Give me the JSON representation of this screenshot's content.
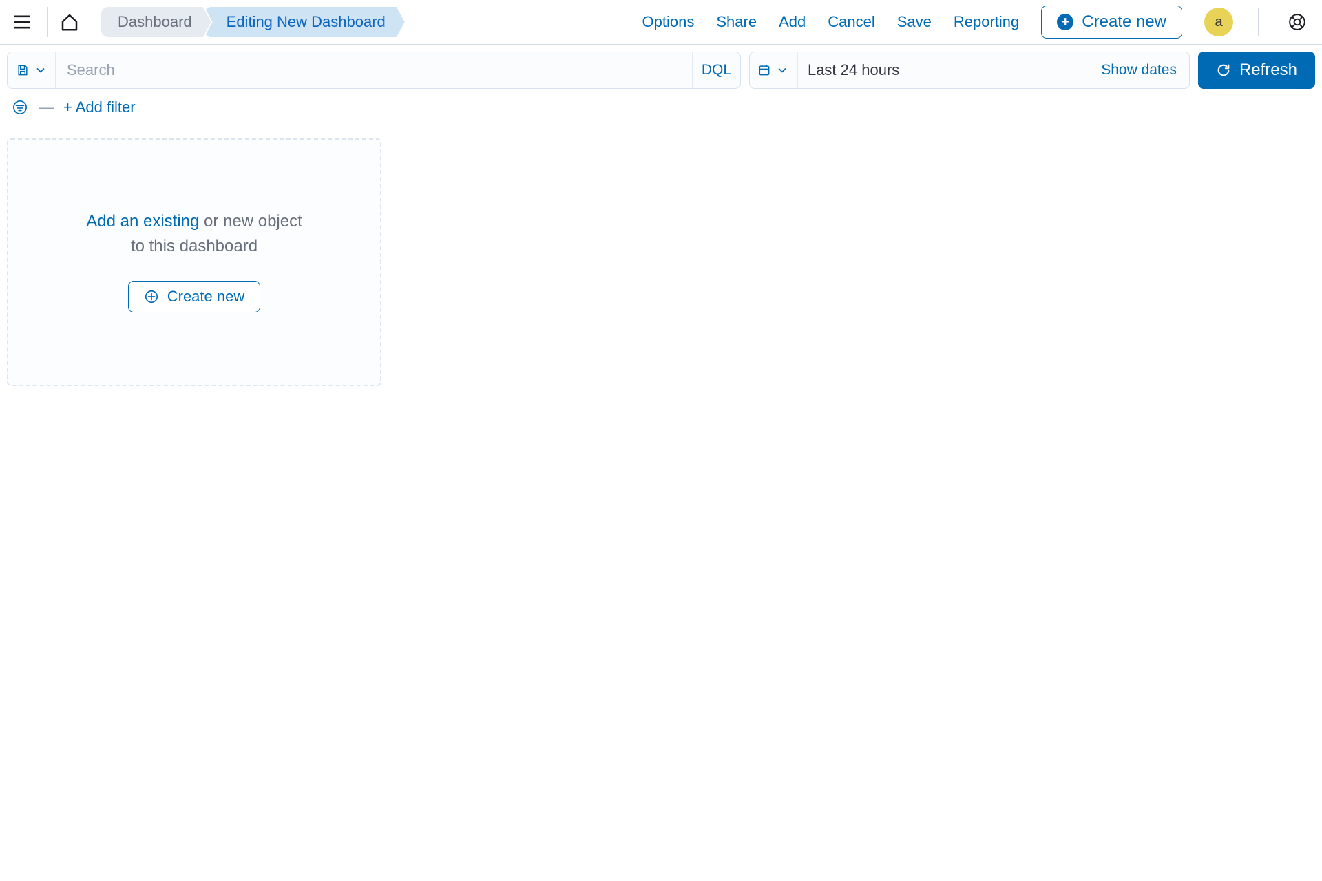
{
  "header": {
    "breadcrumbs": {
      "root": "Dashboard",
      "current": "Editing New Dashboard"
    },
    "actions": {
      "options": "Options",
      "share": "Share",
      "add": "Add",
      "cancel": "Cancel",
      "save": "Save",
      "reporting": "Reporting",
      "create_new": "Create new"
    },
    "avatar_initial": "a"
  },
  "toolbar": {
    "search_placeholder": "Search",
    "search_value": "",
    "dql_label": "DQL",
    "date_value": "Last 24 hours",
    "show_dates": "Show dates",
    "refresh": "Refresh"
  },
  "filters": {
    "add_filter": "+ Add filter"
  },
  "panel": {
    "link_text": "Add an existing",
    "rest_text_1": " or new object",
    "rest_text_2": "to this dashboard",
    "create_new": "Create new"
  }
}
